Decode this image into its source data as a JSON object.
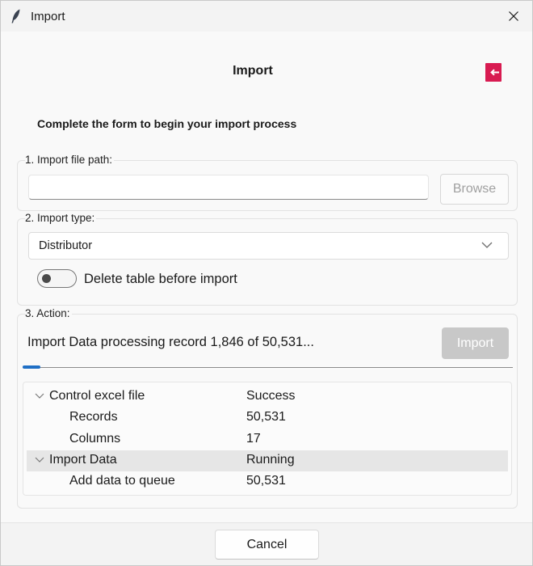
{
  "window": {
    "title": "Import",
    "app_icon": "feather-icon",
    "close_icon": "close-icon"
  },
  "header": {
    "title": "Import",
    "exit_icon": "exit-icon",
    "exit_color": "#d81b51"
  },
  "subtitle": "Complete the form to begin your import process",
  "section1": {
    "label": "1. Import file path:",
    "path_value": "",
    "browse_label": "Browse"
  },
  "section2": {
    "label": "2. Import type:",
    "selected": "Distributor",
    "toggle_label": "Delete table before import",
    "toggle_on": false
  },
  "section3": {
    "label": "3. Action:",
    "status": "Import Data processing record 1,846 of 50,531...",
    "import_label": "Import",
    "progress": 0.0365,
    "accent": "#1f6fc5",
    "tree": [
      {
        "name": "Control excel file",
        "value": "Success",
        "level": 0,
        "expanded": true,
        "selected": false
      },
      {
        "name": "Records",
        "value": "50,531",
        "level": 1,
        "selected": false
      },
      {
        "name": "Columns",
        "value": "17",
        "level": 1,
        "selected": false
      },
      {
        "name": "Import Data",
        "value": "Running",
        "level": 0,
        "expanded": true,
        "selected": true
      },
      {
        "name": "Add data to queue",
        "value": "50,531",
        "level": 1,
        "selected": false
      }
    ]
  },
  "footer": {
    "cancel_label": "Cancel"
  }
}
